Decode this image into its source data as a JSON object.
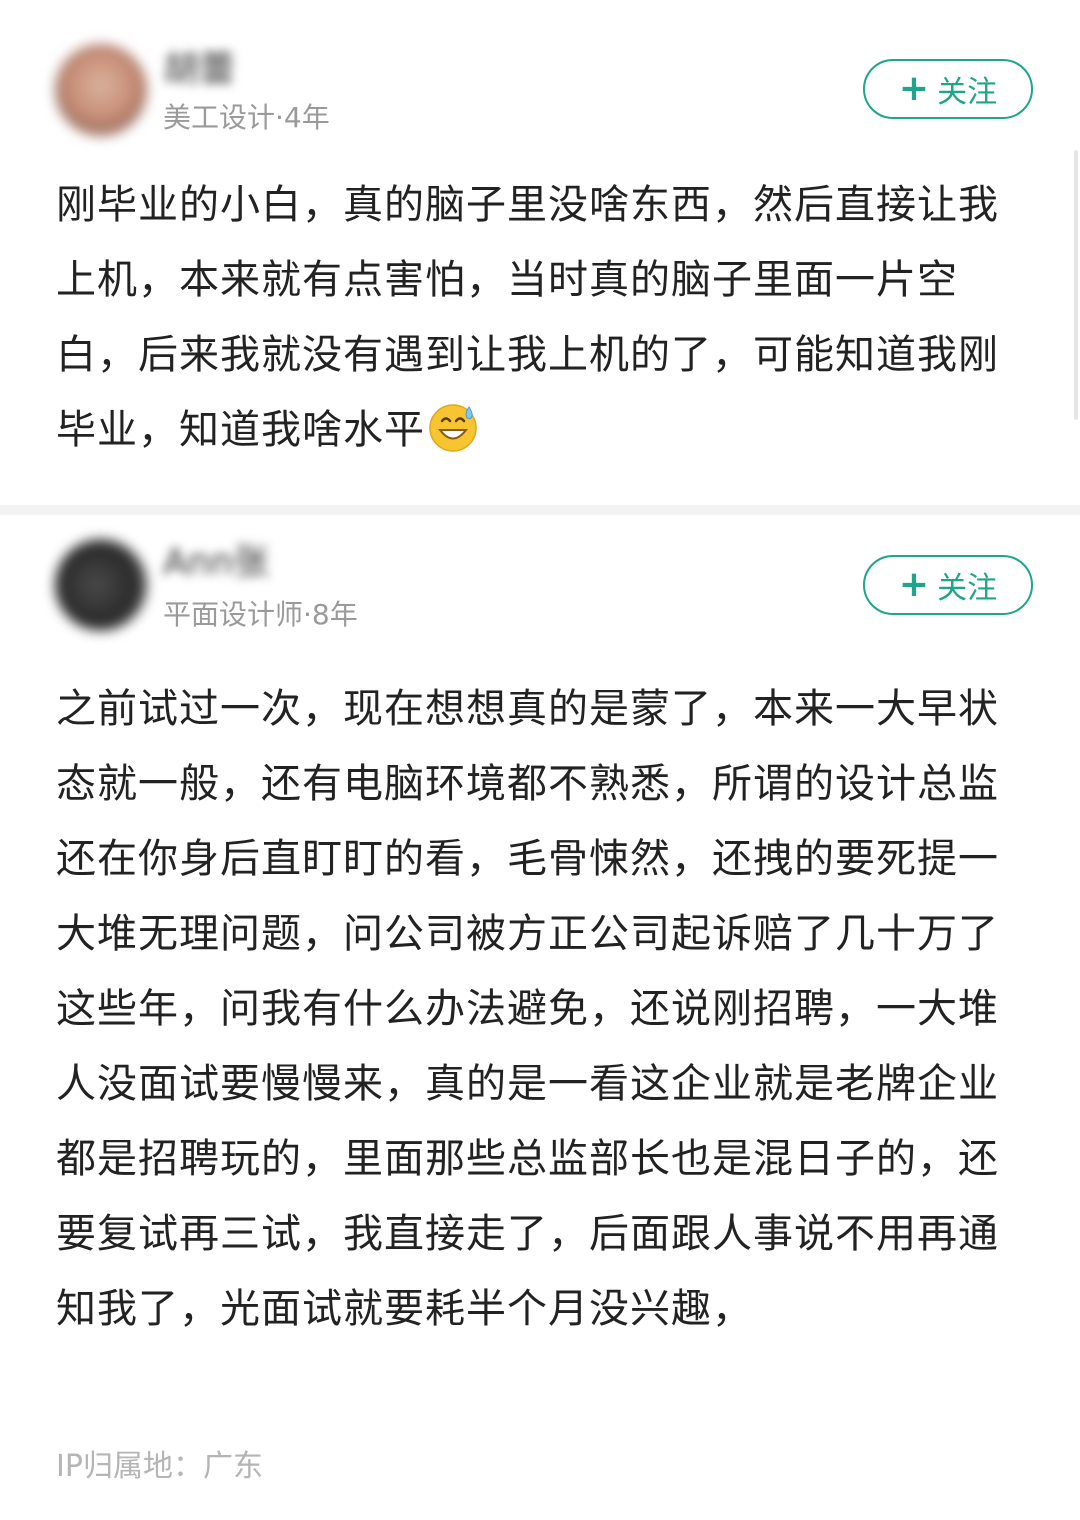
{
  "posts": [
    {
      "username": "胡蕾",
      "meta": "美工设计·4年",
      "follow": {
        "plus": "+",
        "label": "关注"
      },
      "content": "刚毕业的小白，真的脑子里没啥东西，然后直接让我上机，本来就有点害怕，当时真的脑子里面一片空白，后来我就没有遇到让我上机的了，可能知道我刚毕业，知道我啥水平",
      "trailing_icon": "grinning-sweat-emoji"
    },
    {
      "username": "Ann张",
      "meta": "平面设计师·8年",
      "follow": {
        "plus": "+",
        "label": "关注"
      },
      "content": "之前试过一次，现在想想真的是蒙了，本来一大早状态就一般，还有电脑环境都不熟悉，所谓的设计总监还在你身后直盯盯的看，毛骨悚然，还拽的要死提一大堆无理问题，问公司被方正公司起诉赔了几十万了这些年，问我有什么办法避免，还说刚招聘，一大堆人没面试要慢慢来，真的是一看这企业就是老牌企业都是招聘玩的，里面那些总监部长也是混日子的，还要复试再三试，我直接走了，后面跟人事说不用再通知我了，光面试就要耗半个月没兴趣，",
      "ip_location": "IP归属地：广东"
    }
  ],
  "colors": {
    "accent": "#1fa58a",
    "text": "#222222",
    "meta": "#9a9a9a",
    "ip": "#b5b5b5",
    "divider": "#f3f3f3"
  }
}
